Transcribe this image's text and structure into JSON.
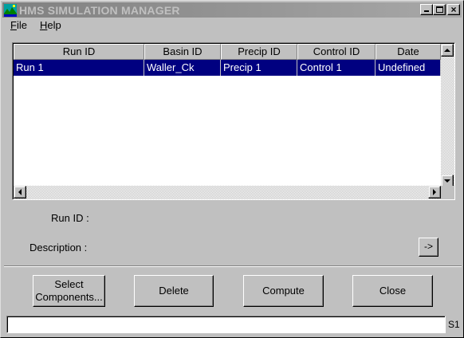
{
  "window": {
    "title": "HMS SIMULATION MANAGER",
    "controls": {
      "minimize": "_",
      "maximize": "□",
      "close": "×"
    }
  },
  "menu": [
    {
      "key": "F",
      "rest": "ile"
    },
    {
      "key": "H",
      "rest": "elp"
    }
  ],
  "table": {
    "columns": [
      "Run ID",
      "Basin ID",
      "Precip ID",
      "Control ID",
      "Date"
    ],
    "rows": [
      {
        "cells": [
          "Run 1",
          "Waller_Ck",
          "Precip 1",
          "Control 1",
          "Undefined"
        ],
        "selected": true
      }
    ]
  },
  "fields": {
    "run_id_label": "Run ID :",
    "description_label": "Description :",
    "arrow_button": "->"
  },
  "buttons": {
    "select_components_line1": "Select",
    "select_components_line2": "Components...",
    "delete": "Delete",
    "compute": "Compute",
    "close": "Close"
  },
  "status": {
    "text": "",
    "tag": "S1"
  },
  "colors": {
    "selection": "#000080",
    "face": "#c0c0c0"
  }
}
